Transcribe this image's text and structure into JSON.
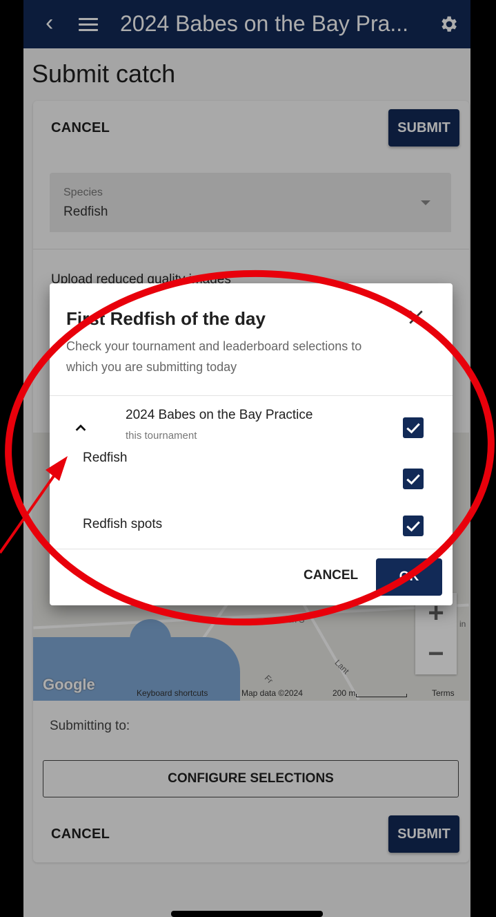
{
  "app_bar": {
    "back_icon": "chevron-left-icon",
    "menu_icon": "hamburger-menu-icon",
    "title": "2024 Babes on the Bay Pra...",
    "settings_icon": "gear-icon"
  },
  "page": {
    "title": "Submit catch"
  },
  "form": {
    "top_cancel": "CANCEL",
    "top_submit": "SUBMIT",
    "species_label": "Species",
    "species_value": "Redfish",
    "upload_label": "Upload reduced quality images",
    "submitting_to": "Submitting to:",
    "configure_button": "CONFIGURE SELECTIONS",
    "bottom_cancel": "CANCEL",
    "bottom_submit": "SUBMIT"
  },
  "map": {
    "google_logo": "Google",
    "keyboard_shortcuts": "Keyboard shortcuts",
    "map_data": "Map data ©2024",
    "scale": "200 m",
    "terms": "Terms",
    "street_1": "Main S",
    "street_2": "Lant",
    "street_3": "Fr",
    "street_4": "in",
    "zoom_in": "+",
    "zoom_out": "−"
  },
  "dialog": {
    "title": "First Redfish of the day",
    "subtitle": "Check your tournament and leaderboard selections to which you are submitting today",
    "tournament_name": "2024 Babes on the Bay Practice",
    "tournament_sub": "this tournament",
    "options": [
      {
        "label": "Redfish",
        "checked": true
      },
      {
        "label": "Redfish spots",
        "checked": true
      }
    ],
    "tournament_checked": true,
    "cancel": "CANCEL",
    "ok": "OK"
  },
  "colors": {
    "primary": "#122a57",
    "annotation": "#e8000b"
  }
}
